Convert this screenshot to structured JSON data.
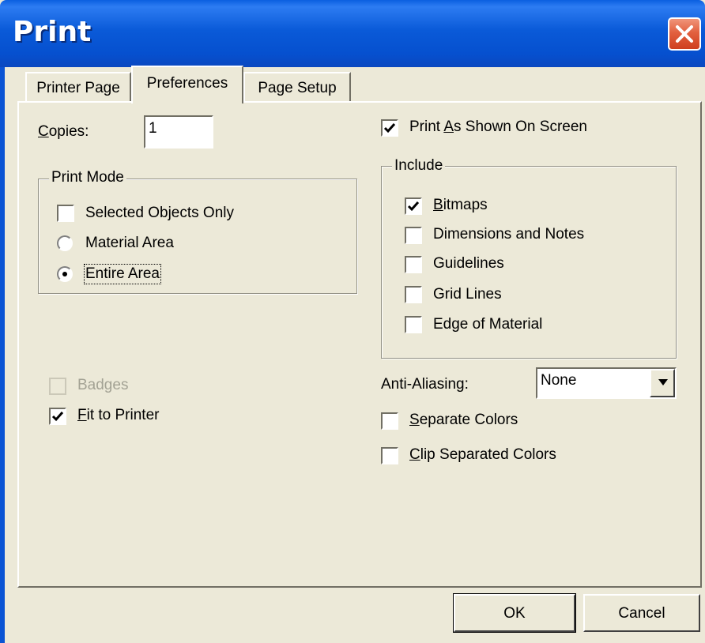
{
  "window": {
    "title": "Print"
  },
  "tabs": [
    {
      "label": "Printer Page",
      "active": false
    },
    {
      "label": "Preferences",
      "active": true
    },
    {
      "label": "Page Setup",
      "active": false
    }
  ],
  "copies": {
    "label": "Copies:",
    "value": "1"
  },
  "print_mode": {
    "legend": "Print Mode",
    "selected_objects_only": {
      "label": "Selected Objects Only",
      "checked": false
    },
    "material_area": {
      "label": "Material Area",
      "selected": false
    },
    "entire_area": {
      "label": "Entire Area",
      "selected": true
    }
  },
  "badges": {
    "label": "Badges",
    "checked": false,
    "enabled": false
  },
  "fit_to_printer": {
    "label": "Fit to Printer",
    "checked": true
  },
  "print_as_shown": {
    "label": "Print As Shown On Screen",
    "checked": true
  },
  "include": {
    "legend": "Include",
    "items": [
      {
        "label": "Bitmaps",
        "checked": true
      },
      {
        "label": "Dimensions and Notes",
        "checked": false
      },
      {
        "label": "Guidelines",
        "checked": false
      },
      {
        "label": "Grid Lines",
        "checked": false
      },
      {
        "label": "Edge of Material",
        "checked": false
      }
    ]
  },
  "anti_aliasing": {
    "label": "Anti-Aliasing:",
    "value": "None"
  },
  "separate_colors": {
    "label": "Separate Colors",
    "checked": false
  },
  "clip_separated_colors": {
    "label": "Clip Separated Colors",
    "checked": false
  },
  "buttons": {
    "ok": "OK",
    "cancel": "Cancel"
  },
  "colors": {
    "title_bar": "#0a5ad8",
    "dialog_bg": "#ece9d8",
    "close_button": "#e2603f"
  }
}
